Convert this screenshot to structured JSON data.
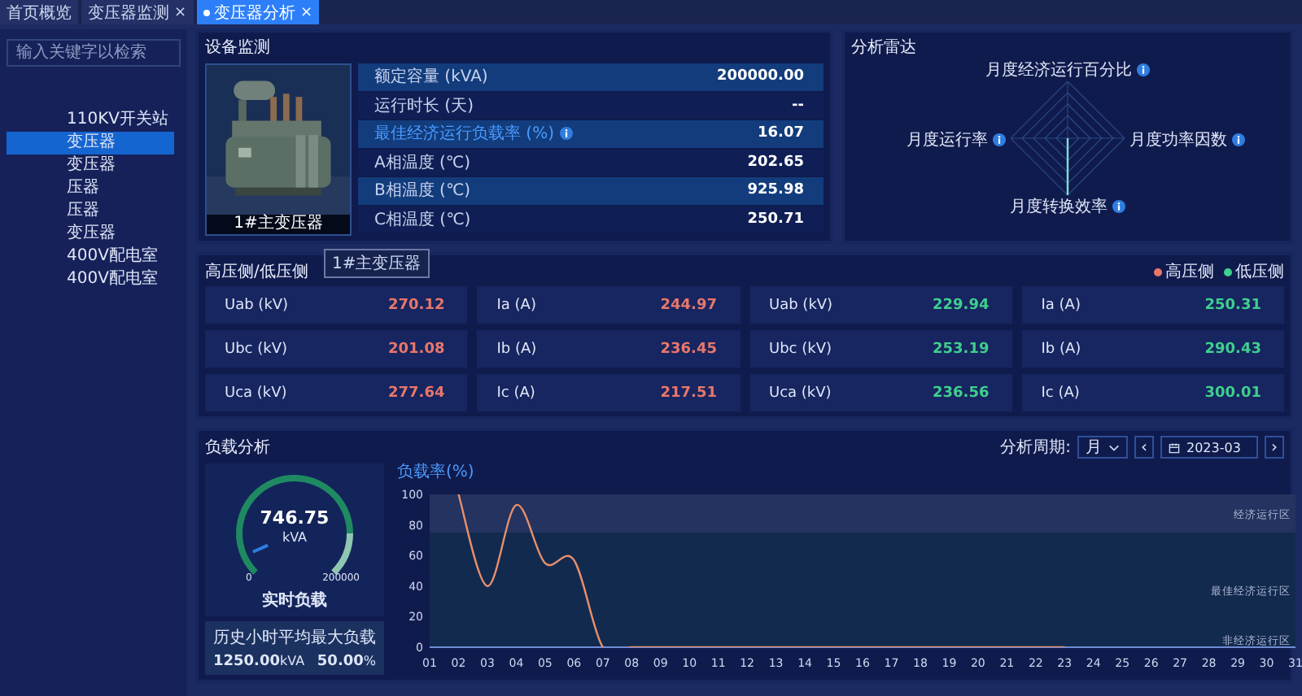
{
  "tabs": [
    {
      "label": "首页概览",
      "selected": false
    },
    {
      "label": "变压器监测",
      "selected": false,
      "close_icon": "×"
    },
    {
      "label": "变压器分析",
      "selected": true,
      "close_icon": "×"
    }
  ],
  "sidebar": {
    "search": {
      "placeholder": "输入关键字以检索"
    },
    "items": [
      {
        "label": "110KV开关站",
        "selected": false
      },
      {
        "label": "变压器",
        "selected": true
      },
      {
        "label": "变压器",
        "selected": false
      },
      {
        "label": "压器",
        "selected": false
      },
      {
        "label": "压器",
        "selected": false
      },
      {
        "label": "变压器",
        "selected": false
      },
      {
        "label": "400V配电室",
        "selected": false
      },
      {
        "label": "400V配电室",
        "selected": false
      }
    ]
  },
  "device_monitor": {
    "title": "设备监测",
    "image_caption": "1#主变压器",
    "tooltip": "1#主变压器",
    "rows": [
      {
        "label": "额定容量 (kVA)",
        "value": "200000.00",
        "highlight": false,
        "info": false
      },
      {
        "label": "运行时长 (天)",
        "value": "--",
        "highlight": false,
        "info": false
      },
      {
        "label": "最佳经济运行负载率 (%)",
        "value": "16.07",
        "highlight": true,
        "info": true
      },
      {
        "label": "A相温度 (℃)",
        "value": "202.65",
        "highlight": false,
        "info": false
      },
      {
        "label": "B相温度 (℃)",
        "value": "925.98",
        "highlight": false,
        "info": false
      },
      {
        "label": "C相温度 (℃)",
        "value": "250.71",
        "highlight": false,
        "info": false
      }
    ]
  },
  "radar": {
    "title": "分析雷达",
    "axes": [
      {
        "label": "月度经济运行百分比"
      },
      {
        "label": "月度运行率"
      },
      {
        "label": "月度功率因数"
      },
      {
        "label": "月度转换效率"
      }
    ]
  },
  "voltage_current": {
    "title": "高压侧/低压侧",
    "sides": [
      {
        "name": "高压侧",
        "color": "#e8776a",
        "cells": [
          {
            "label": "Uab (kV)",
            "value": "270.12"
          },
          {
            "label": "Ubc (kV)",
            "value": "201.08"
          },
          {
            "label": "Uca (kV)",
            "value": "277.64"
          },
          {
            "label": "Ia (A)",
            "value": "244.97"
          },
          {
            "label": "Ib (A)",
            "value": "236.45"
          },
          {
            "label": "Ic (A)",
            "value": "217.51"
          }
        ]
      },
      {
        "name": "低压侧",
        "color": "#3fcf8e",
        "cells": [
          {
            "label": "Uab (kV)",
            "value": "229.94"
          },
          {
            "label": "Ubc (kV)",
            "value": "253.19"
          },
          {
            "label": "Uca (kV)",
            "value": "236.56"
          },
          {
            "label": "Ia (A)",
            "value": "250.31"
          },
          {
            "label": "Ib (A)",
            "value": "290.43"
          },
          {
            "label": "Ic (A)",
            "value": "300.01"
          }
        ]
      }
    ]
  },
  "load_analysis": {
    "title": "负载分析",
    "period_label": "分析周期:",
    "period": "月",
    "prev_icon": "‹",
    "date": "2023-03",
    "next_icon": "›",
    "gauge": {
      "value": "746.75",
      "unit": "kVA",
      "min": "0",
      "max": "200000",
      "caption": "实时负载"
    },
    "history": {
      "title": "历史小时平均最大负载",
      "value": "1250.00",
      "unit": "kVA",
      "percent": "50.00",
      "percent_unit": "%"
    },
    "chart_data": {
      "type": "line",
      "ylabel": "负载率(%)",
      "x": [
        "01",
        "02",
        "03",
        "04",
        "05",
        "06",
        "07",
        "08",
        "09",
        "10",
        "11",
        "12",
        "13",
        "14",
        "15",
        "16",
        "17",
        "18",
        "19",
        "20",
        "21",
        "22",
        "23",
        "24",
        "25",
        "26",
        "27",
        "28",
        "29",
        "30",
        "31"
      ],
      "series": [
        {
          "color": "#e8906a",
          "values": [
            null,
            100,
            40,
            93,
            55,
            57,
            0,
            0,
            0,
            0,
            0,
            0,
            0,
            0,
            0,
            0,
            0,
            0,
            0,
            0,
            0,
            0,
            0,
            null,
            null,
            null,
            null,
            null,
            null,
            null,
            null
          ]
        }
      ],
      "ylim": [
        0,
        100
      ],
      "yticks": [
        0,
        20,
        40,
        60,
        80,
        100
      ],
      "annotations": [
        "经济运行区",
        "最佳经济运行区",
        "非经济运行区"
      ]
    }
  }
}
